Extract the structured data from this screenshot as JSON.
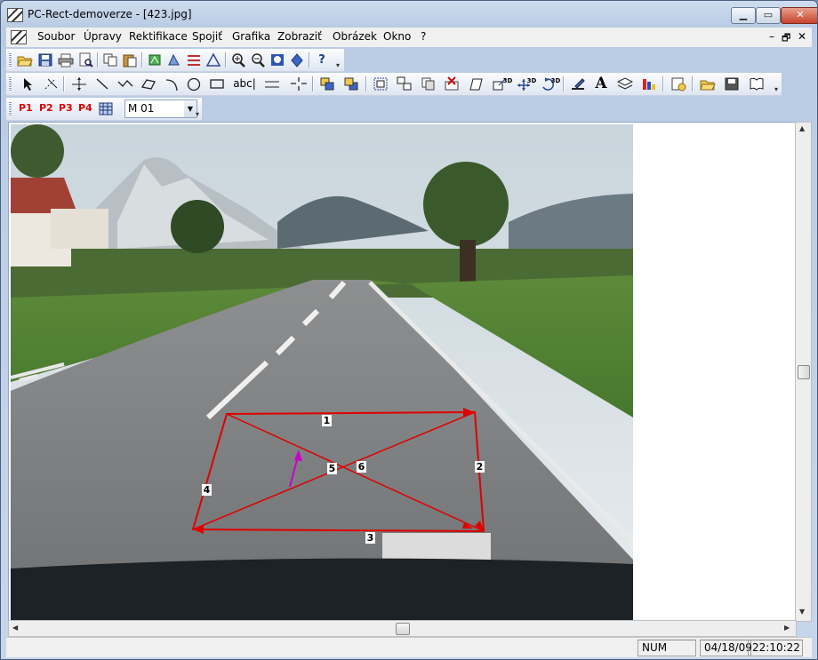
{
  "window": {
    "title": "PC-Rect-demoverze - [423.jpg]",
    "minimize_label": "▁",
    "maximize_label": "▭",
    "close_label": "✕"
  },
  "menubar": {
    "items": [
      "Soubor",
      "Úpravy",
      "Rektifikace",
      "Spojiť",
      "Grafika",
      "Zobraziť",
      "Obrázek",
      "Okno",
      "?"
    ],
    "mdi_minimize": "–",
    "mdi_restore": "🗗",
    "mdi_close": "✕"
  },
  "toolbar3": {
    "point_tags": [
      "P1",
      "P2",
      "P3",
      "P4"
    ],
    "combo_value": "M 01",
    "tag_color": "#dd0000"
  },
  "toolbar2": {
    "text_tool_label": "abc|",
    "font_tool_label": "A",
    "badge_3d": "3D"
  },
  "overlay": {
    "labels": [
      "1",
      "2",
      "3",
      "4",
      "5",
      "6"
    ],
    "line_color": "#e00000",
    "arrow_color": "#cc00cc"
  },
  "statusbar": {
    "left": "",
    "num": "NUM",
    "date": "04/18/09",
    "time": "22:10:22"
  }
}
